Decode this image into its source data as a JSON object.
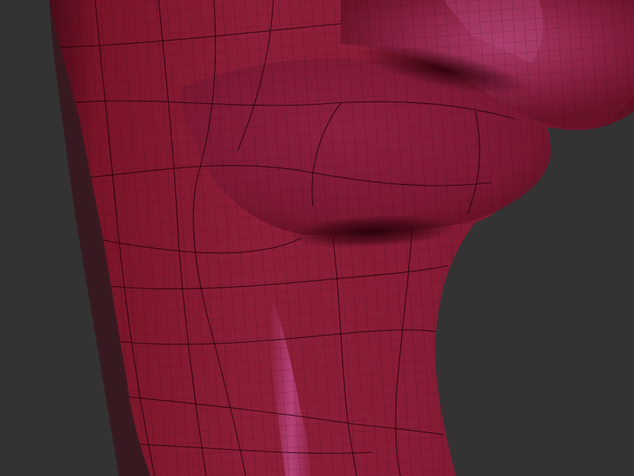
{
  "viewport": {
    "background_color": "#333333",
    "mesh": {
      "material_color": "#8a1d35",
      "shadow_color": "#3a0510",
      "highlight_color": "#c04c8c",
      "wire_color": "#2a0510",
      "polygroup_line_color": "#1a0008"
    }
  }
}
